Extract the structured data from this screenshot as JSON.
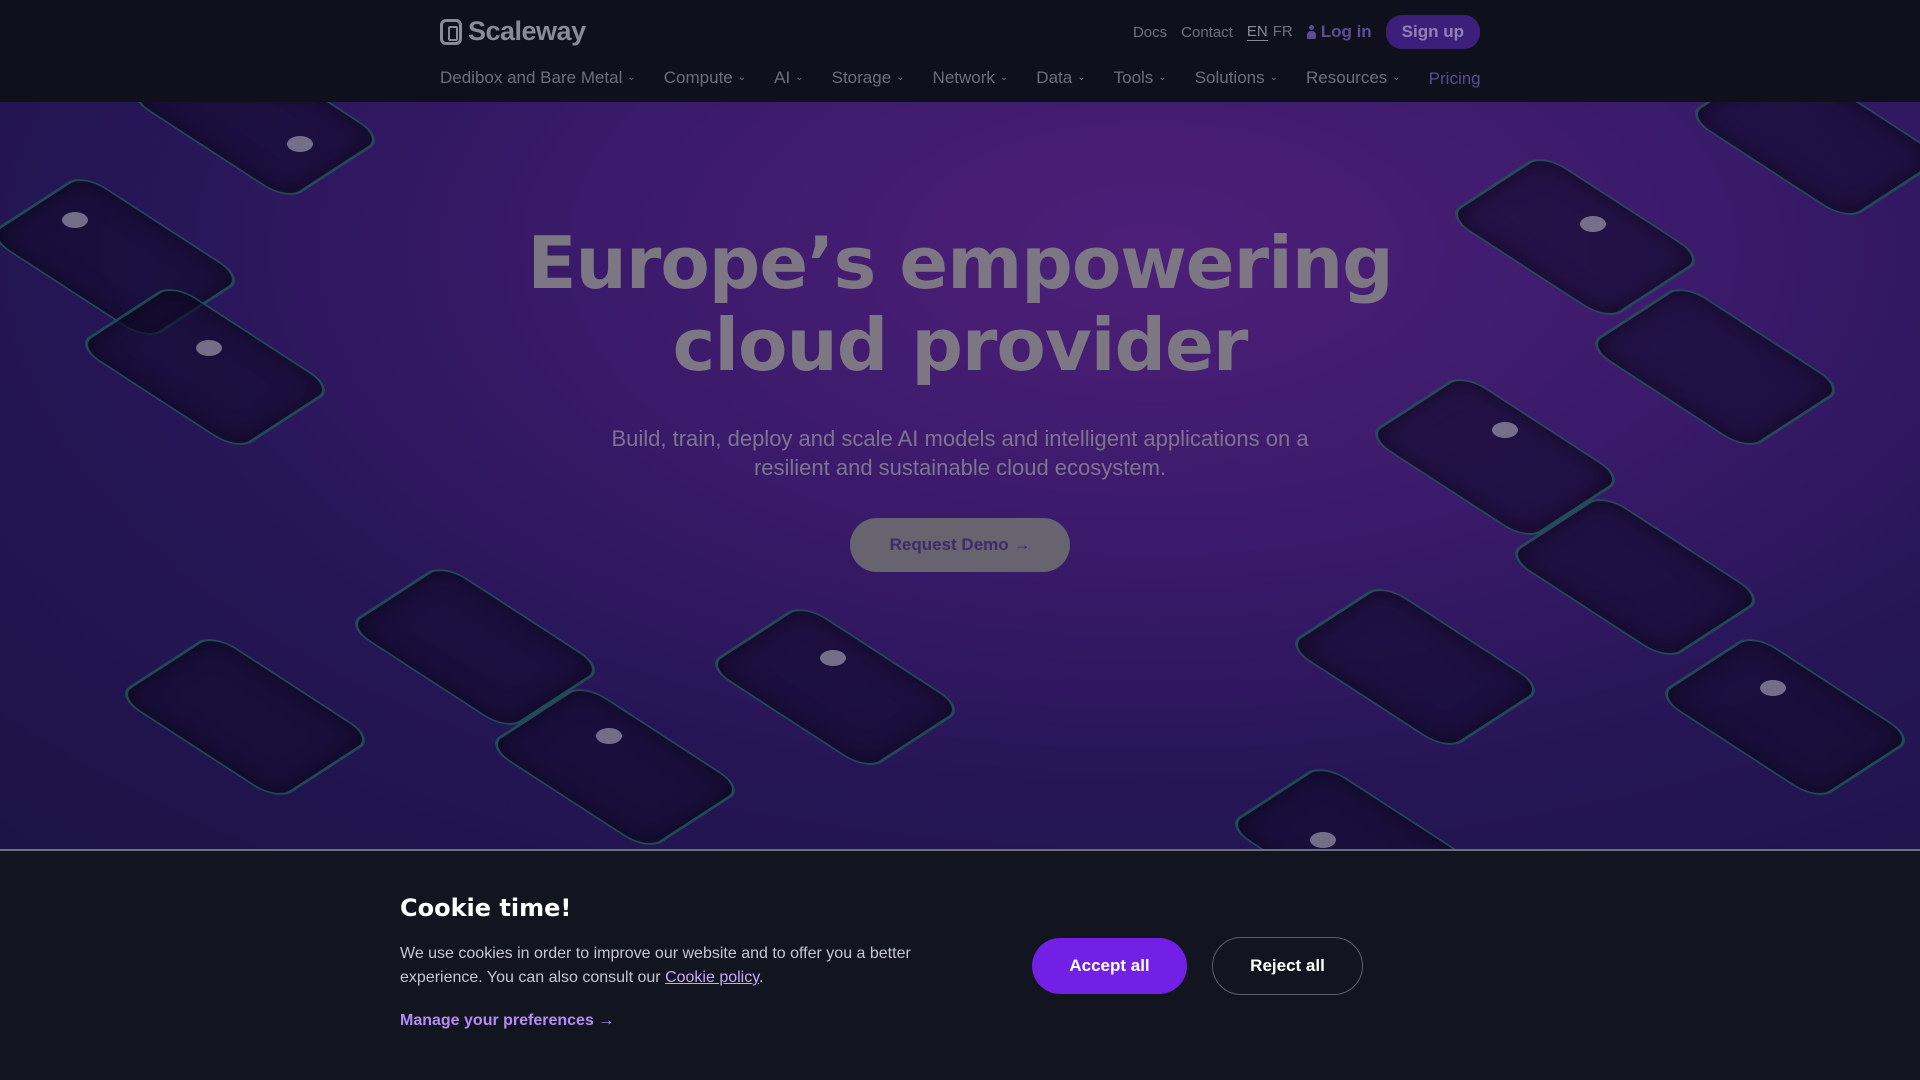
{
  "header": {
    "logo": "Scaleway",
    "top_links": {
      "docs": "Docs",
      "contact": "Contact",
      "lang_en": "EN",
      "lang_fr": "FR",
      "login": "Log in",
      "signup": "Sign up"
    },
    "nav": [
      {
        "label": "Dedibox and Bare Metal"
      },
      {
        "label": "Compute"
      },
      {
        "label": "AI"
      },
      {
        "label": "Storage"
      },
      {
        "label": "Network"
      },
      {
        "label": "Data"
      },
      {
        "label": "Tools"
      },
      {
        "label": "Solutions"
      },
      {
        "label": "Resources"
      }
    ],
    "pricing": "Pricing"
  },
  "hero": {
    "title_line1": "Europe’s empowering",
    "title_line2": "cloud provider",
    "subtitle": "Build, train, deploy and scale AI models and intelligent applications on a resilient and sustainable cloud ecosystem.",
    "cta": "Request Demo →"
  },
  "cookie": {
    "title": "Cookie time!",
    "body": "We use cookies in order to improve our website and to offer you a better experience. You can also consult our ",
    "policy_link": "Cookie policy",
    "body_end": ".",
    "manage": "Manage your preferences →",
    "accept": "Accept all",
    "reject": "Reject all"
  },
  "colors": {
    "accent": "#7220e6",
    "link": "#b58cf5",
    "banner_bg": "#12141f"
  }
}
